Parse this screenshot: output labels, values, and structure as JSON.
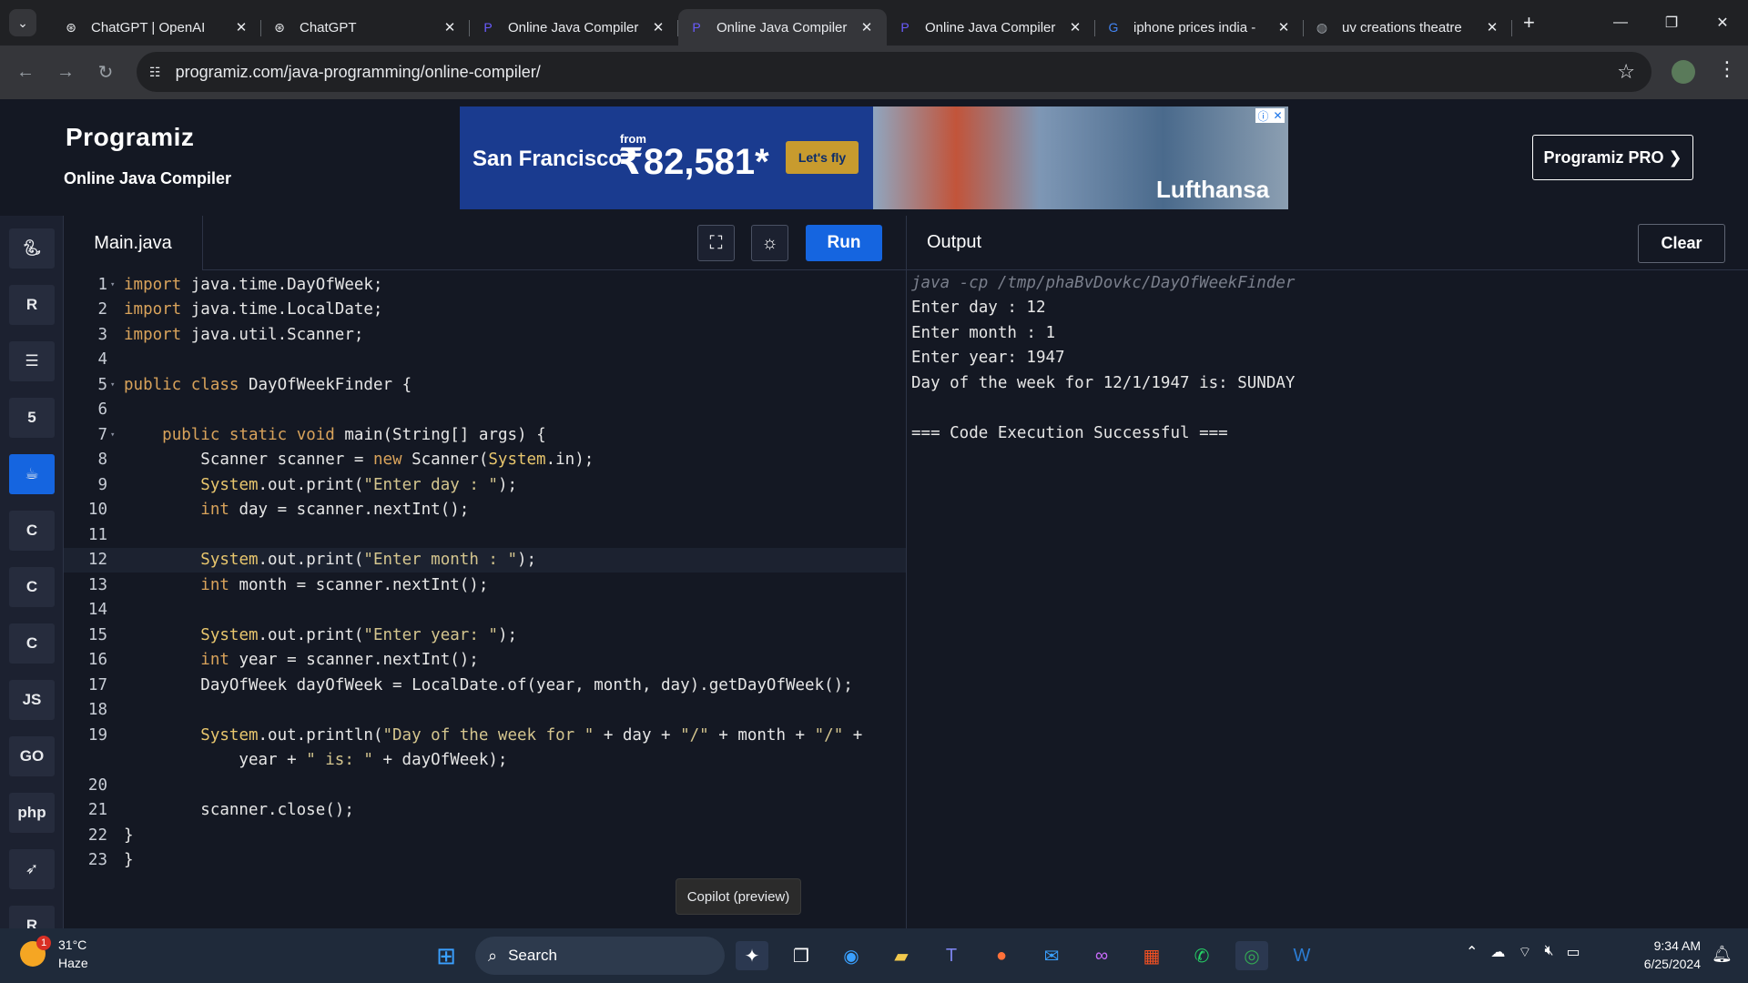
{
  "browser": {
    "tabs": [
      {
        "title": "ChatGPT | OpenAI",
        "icon": "chatgpt-icon",
        "active": false
      },
      {
        "title": "ChatGPT",
        "icon": "chatgpt-icon",
        "active": false
      },
      {
        "title": "Online Java Compiler",
        "icon": "programiz-icon",
        "active": false
      },
      {
        "title": "Online Java Compiler",
        "icon": "programiz-icon",
        "active": true
      },
      {
        "title": "Online Java Compiler",
        "icon": "programiz-icon",
        "active": false
      },
      {
        "title": "iphone prices india -",
        "icon": "google-icon",
        "active": false
      },
      {
        "title": "uv creations theatre",
        "icon": "globe-icon",
        "active": false
      }
    ],
    "url": "programiz.com/java-programming/online-compiler/"
  },
  "header": {
    "logo": "Programiz",
    "subtitle": "Online Java Compiler",
    "pro_button": "Programiz PRO ❯"
  },
  "ad": {
    "destination": "San Francisco",
    "from": "from",
    "price": "₹82,581*",
    "cta": "Let's fly",
    "brand": "Lufthansa"
  },
  "editor": {
    "file_tab": "Main.java",
    "run_label": "Run",
    "lines": [
      "import java.time.DayOfWeek;",
      "import java.time.LocalDate;",
      "import java.util.Scanner;",
      "",
      "public class DayOfWeekFinder {",
      "",
      "    public static void main(String[] args) {",
      "        Scanner scanner = new Scanner(System.in);",
      "        System.out.print(\"Enter day : \");",
      "        int day = scanner.nextInt();",
      "",
      "        System.out.print(\"Enter month : \");",
      "        int month = scanner.nextInt();",
      "",
      "        System.out.print(\"Enter year: \");",
      "        int year = scanner.nextInt();",
      "        DayOfWeek dayOfWeek = LocalDate.of(year, month, day).getDayOfWeek();",
      "",
      "        System.out.println(\"Day of the week for \" + day + \"/\" + month + \"/\" +",
      "            year + \" is: \" + dayOfWeek);",
      "",
      "        scanner.close();",
      "}",
      "}"
    ],
    "line_numbers": [
      "1",
      "2",
      "3",
      "4",
      "5",
      "6",
      "7",
      "8",
      "9",
      "10",
      "11",
      "12",
      "13",
      "14",
      "15",
      "16",
      "17",
      "18",
      "19",
      "",
      "20",
      "21",
      "22",
      "23"
    ]
  },
  "output": {
    "title": "Output",
    "clear_label": "Clear",
    "lines": [
      "java -cp /tmp/phaBvDovkc/DayOfWeekFinder",
      "Enter day : 12",
      "Enter month : 1",
      "Enter year: 1947",
      "Day of the week for 12/1/1947 is: SUNDAY",
      "",
      "=== Code Execution Successful ==="
    ]
  },
  "tooltip": "Copilot (preview)",
  "taskbar": {
    "temperature": "31°C",
    "weather": "Haze",
    "weather_badge": "1",
    "search_label": "Search",
    "time": "9:34 AM",
    "date": "6/25/2024"
  },
  "languages": [
    "python",
    "r",
    "sql",
    "html",
    "java",
    "c",
    "cpp",
    "csharp",
    "js",
    "go",
    "php",
    "swift",
    "rust"
  ]
}
